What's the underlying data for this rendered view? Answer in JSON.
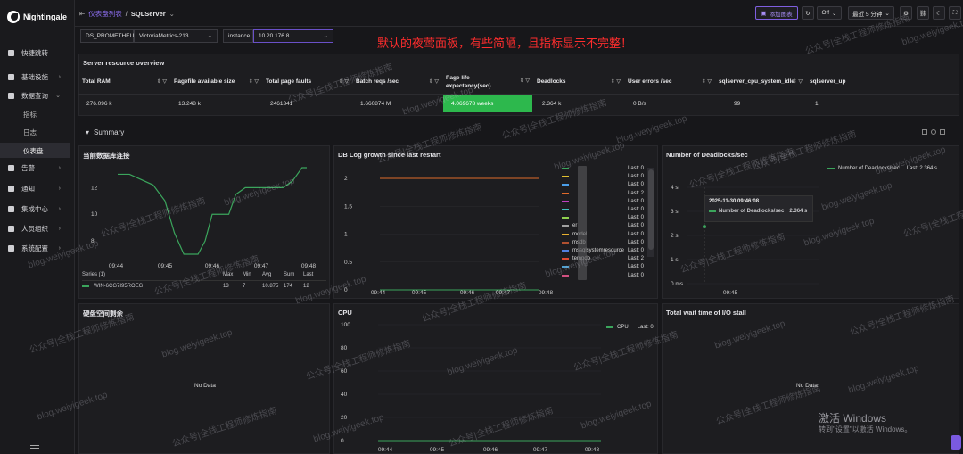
{
  "app": {
    "name": "Nightingale"
  },
  "sidebar": {
    "items": [
      {
        "label": "快捷跳转"
      },
      {
        "label": "基础设施"
      },
      {
        "label": "数据查询"
      },
      {
        "label": "告警"
      },
      {
        "label": "通知"
      },
      {
        "label": "集成中心"
      },
      {
        "label": "人员组织"
      },
      {
        "label": "系统配置"
      }
    ],
    "sub_items": [
      {
        "label": "指标"
      },
      {
        "label": "日志"
      },
      {
        "label": "仪表盘"
      }
    ]
  },
  "header": {
    "breadcrumb_parent": "仪表盘列表",
    "breadcrumb_sep": "/",
    "title": "SQLServer",
    "add_chart": "添加图表",
    "refresh_off": "Off",
    "time_range": "最近 5 分钟"
  },
  "vars": {
    "datasource_type": "DS_PROMETHEUS",
    "datasource_value": "VictoriaMetrics-213",
    "instance_label": "instance",
    "instance_value": "10.20.176.8"
  },
  "annotation": "默认的夜莺面板，有些简陋，且指标显示不完整！",
  "overview": {
    "title": "Server resource overview",
    "columns": [
      "Total RAM",
      "Pagefile available size",
      "Total page faults",
      "Batch reqs /sec",
      "Page life expectancy(sec)",
      "Deadlocks",
      "User errors /sec",
      "sqlserver_cpu_system_idle",
      "sqlserver_up"
    ],
    "values": [
      "276.096 k",
      "13.248 k",
      "2461341",
      "1.660874 M",
      "4.069678 weeks",
      "2.364 k",
      "0 B/s",
      "99",
      "1"
    ]
  },
  "summary": {
    "label": "Summary"
  },
  "panels": {
    "db_conn": {
      "title": "当前数据库连接",
      "legend_header": "Series (1)",
      "legend_cols": [
        "Max",
        "Min",
        "Avg",
        "Sum",
        "Last"
      ],
      "series_name": "WIN-6CG7I95ROEG",
      "stats": [
        "13",
        "7",
        "10.875",
        "174",
        "12"
      ]
    },
    "log_growth": {
      "title": "DB Log growth since last restart",
      "legend": [
        {
          "name": "",
          "last": "Last: 0",
          "color": "#3ba55c"
        },
        {
          "name": "",
          "last": "Last: 0",
          "color": "#e0c030"
        },
        {
          "name": "",
          "last": "Last: 0",
          "color": "#4a9ee8"
        },
        {
          "name": "",
          "last": "Last: 2",
          "color": "#e06a2a"
        },
        {
          "name": "",
          "last": "Last: 0",
          "color": "#c040c0"
        },
        {
          "name": "",
          "last": "Last: 0",
          "color": "#40c0c0"
        },
        {
          "name": "",
          "last": "Last: 0",
          "color": "#8fd14f"
        },
        {
          "name": "er",
          "last": "Last: 0",
          "color": "#a0a0a0"
        },
        {
          "name": "model",
          "last": "Last: 0",
          "color": "#e8b030"
        },
        {
          "name": "msdb",
          "last": "Last: 0",
          "color": "#b05030"
        },
        {
          "name": "mssqlsystemresource",
          "last": "Last: 0",
          "color": "#5080e0"
        },
        {
          "name": "tempdb",
          "last": "Last: 2",
          "color": "#e04a30"
        },
        {
          "name": "",
          "last": "Last: 0",
          "color": "#50a0d0"
        },
        {
          "name": "",
          "last": "Last: 0",
          "color": "#d05080"
        }
      ]
    },
    "deadlocks": {
      "title": "Number of Deadlocks/sec",
      "legend": "Number of Deadlocks/sec",
      "legend_last": "Last: 2.364 s",
      "tooltip_time": "2025-11-30 09:46:08",
      "tooltip_series": "Number of Deadlocks/sec",
      "tooltip_value": "2.364 s"
    },
    "disk_space": {
      "title": "硬盘空间剩余",
      "nodata": "No Data"
    },
    "cpu": {
      "title": "CPU",
      "legend": "CPU",
      "legend_last": "Last: 0"
    },
    "io_stall": {
      "title": "Total wait time of I/O stall",
      "nodata": "No Data"
    }
  },
  "chart_data": [
    {
      "type": "line",
      "title": "当前数据库连接",
      "x": [
        "09:44",
        "09:45",
        "09:46",
        "09:47",
        "09:48"
      ],
      "yticks": [
        "8",
        "10",
        "12"
      ],
      "ylim": [
        7,
        13.5
      ],
      "series": [
        {
          "name": "WIN-6CG7I95ROEG",
          "points": [
            [
              0,
              13
            ],
            [
              0.5,
              13
            ],
            [
              1,
              12.6
            ],
            [
              1.5,
              12.2
            ],
            [
              2,
              11
            ],
            [
              2.4,
              8.6
            ],
            [
              2.8,
              7
            ],
            [
              3.4,
              7
            ],
            [
              3.7,
              8
            ],
            [
              4,
              10
            ],
            [
              4.4,
              10
            ],
            [
              4.7,
              10
            ],
            [
              5,
              11.5
            ],
            [
              5.4,
              12
            ],
            [
              6,
              12
            ],
            [
              6.6,
              12
            ],
            [
              7,
              12
            ],
            [
              7.4,
              12.5
            ],
            [
              7.8,
              13.5
            ],
            [
              8,
              13.5
            ]
          ]
        }
      ]
    },
    {
      "type": "line",
      "title": "DB Log growth since last restart",
      "x": [
        "09:44",
        "09:45",
        "09:46",
        "09:47",
        "09:48"
      ],
      "yticks": [
        "0",
        "0.5",
        "1",
        "1.5",
        "2"
      ],
      "ylim": [
        0,
        2
      ],
      "series": [
        {
          "name": "tempdb",
          "values": [
            2,
            2,
            2,
            2,
            2
          ]
        },
        {
          "name": "other",
          "values": [
            0,
            0,
            0,
            0,
            0
          ]
        }
      ]
    },
    {
      "type": "line",
      "title": "Number of Deadlocks/sec",
      "x": [
        "09:45"
      ],
      "yticks": [
        "0 ms",
        "1 s",
        "2 s",
        "3 s",
        "4 s"
      ],
      "ylim": [
        0,
        4
      ],
      "series": [
        {
          "name": "Number of Deadlocks/sec",
          "values": [
            2.364
          ]
        }
      ]
    },
    {
      "type": "line",
      "title": "CPU",
      "x": [
        "09:44",
        "09:45",
        "09:46",
        "09:47",
        "09:48"
      ],
      "yticks": [
        "0",
        "20",
        "40",
        "60",
        "80",
        "100"
      ],
      "ylim": [
        0,
        100
      ],
      "series": [
        {
          "name": "CPU",
          "values": [
            0,
            0,
            0,
            0,
            0
          ]
        }
      ]
    }
  ],
  "watermark": {
    "line1": "公众号|全栈工程师修炼指南",
    "line2": "blog.weiyigeek.top"
  },
  "windows": {
    "line1": "激活 Windows",
    "line2": "转到\"设置\"以激活 Windows。"
  },
  "colors": {
    "accent": "#8c6ef0",
    "green": "#2db84d",
    "red": "#ff2d2d"
  }
}
